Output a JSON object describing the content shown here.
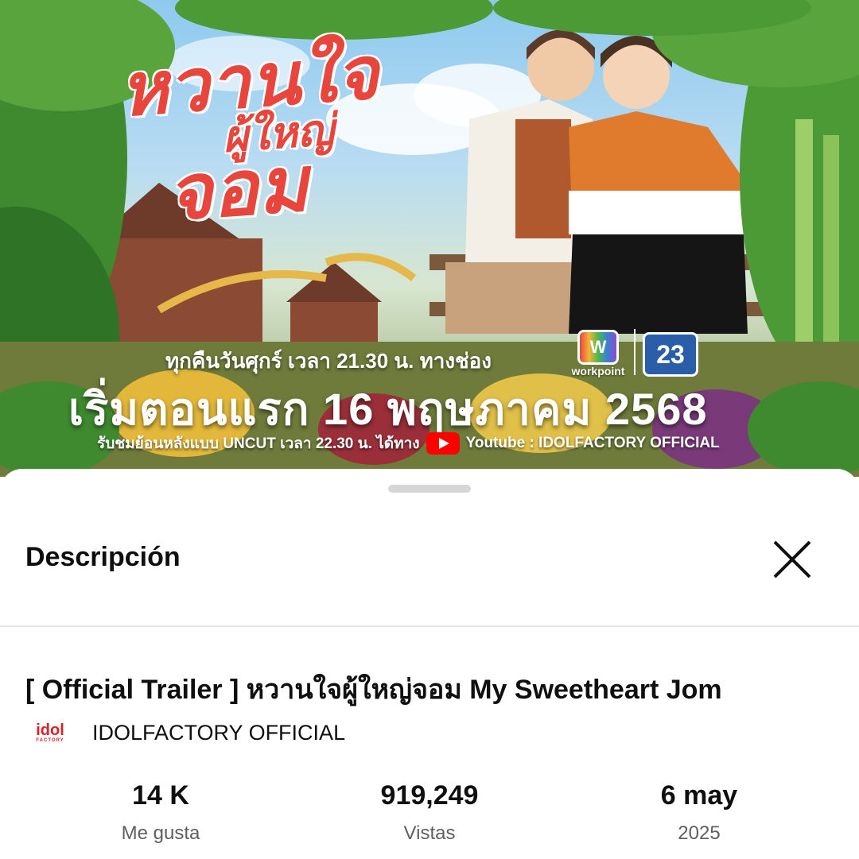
{
  "poster": {
    "title_line1": "หวานใจ",
    "title_line2": "ผู้ใหญ่",
    "title_line3": "จอม",
    "air_time": "ทุกคืนวันศุกร์ เวลา 21.30 น. ทางช่อง",
    "premiere": "เริ่มตอนแรก 16 พฤษภาคม 2568",
    "uncut_prefix": "รับชมย้อนหลังแบบ UNCUT เวลา 22.30 น. ได้ทาง",
    "uncut_channel": "Youtube : IDOLFACTORY OFFICIAL",
    "network_logo_label": "workpoint",
    "network_logo_mark": "W",
    "channel_number": "23"
  },
  "sheet": {
    "title": "Descripción",
    "video_title": "[ Official Trailer ] หวานใจผู้ใหญ่จอม My Sweetheart Jom",
    "channel": {
      "logo_text": "idol",
      "logo_subtext": "FACTORY",
      "name": "IDOLFACTORY OFFICIAL"
    },
    "stats": [
      {
        "value": "14 K",
        "label": "Me gusta"
      },
      {
        "value": "919,249",
        "label": "Vistas"
      },
      {
        "value": "6 may",
        "label": "2025"
      }
    ]
  },
  "colors": {
    "title_red": "#e8453c",
    "youtube_red": "#ff0000",
    "secondary_text": "#606060"
  }
}
